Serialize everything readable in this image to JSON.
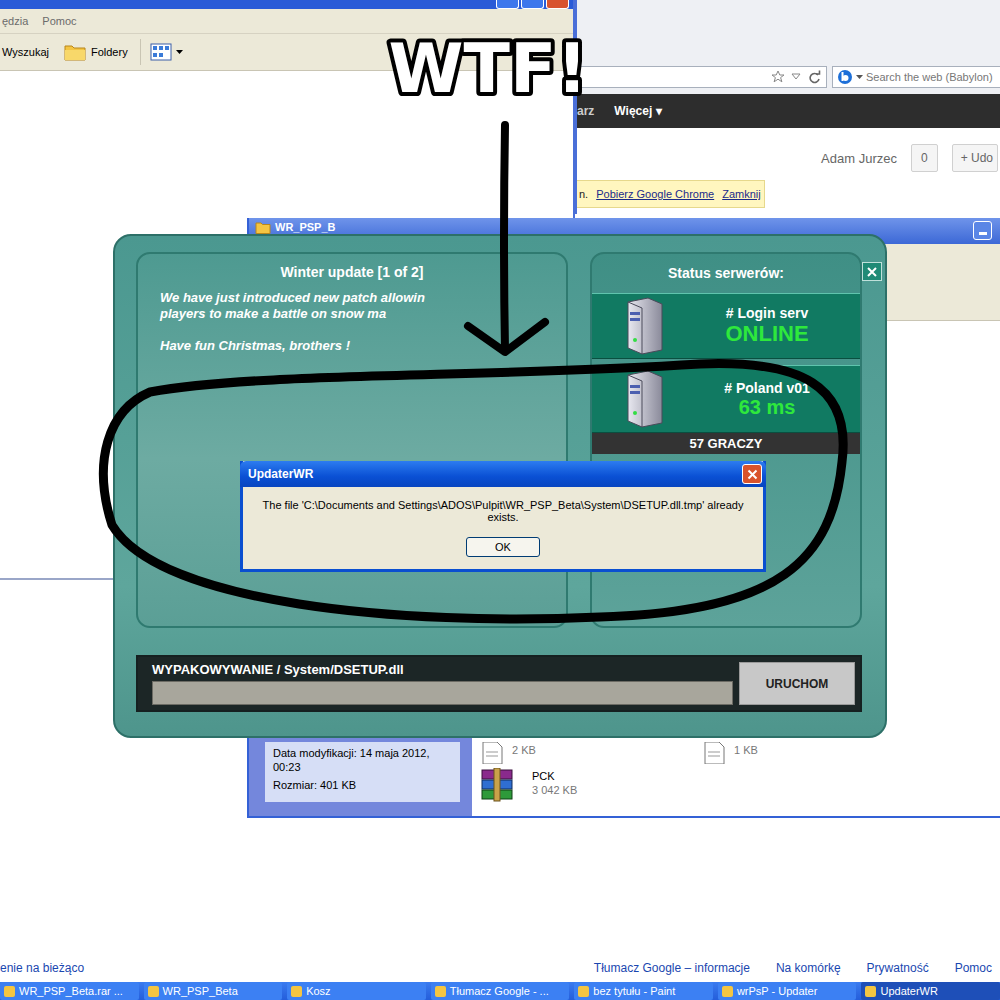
{
  "annotation": {
    "text": "WTF!"
  },
  "explorer": {
    "menu": [
      "ędzia",
      "Pomoc"
    ],
    "toolbar": [
      {
        "label": "Wyszukaj",
        "kind": "search"
      },
      {
        "label": "Foldery",
        "kind": "folders"
      }
    ]
  },
  "browser": {
    "search_placeholder": "Search the web (Babylon)",
    "nav": [
      "arz",
      "Więcej ▾"
    ],
    "user": "Adam Jurzec",
    "count": "0",
    "share": "+ Udo",
    "notice": {
      "prefix": "n.",
      "links": [
        "Pobierz Google Chrome",
        "Zamknij"
      ]
    }
  },
  "folder_window": {
    "title": "WR_PSP_B",
    "details": [
      "Data modyfikacji: 14 maja 2012,",
      "00:23"
    ],
    "size": "Rozmiar: 401 KB",
    "files": [
      {
        "kind": "file",
        "lines": [
          "2 KB"
        ]
      },
      {
        "kind": "file",
        "lines": [
          "1 KB"
        ]
      },
      {
        "kind": "archive",
        "lines": [
          "PCK",
          "3 042 KB"
        ]
      }
    ]
  },
  "updater": {
    "news": {
      "title": "Winter update [1 of 2]",
      "lines": [
        "We have just introduced new patch allowin",
        "players to make a battle on snow ma"
      ],
      "footer": "Have fun Christmas, brothers !"
    },
    "status_title": "Status serwerów:",
    "servers": [
      {
        "name": "# Login serv",
        "value": "ONLINE",
        "kind": "status"
      },
      {
        "name": "# Poland v01",
        "value": "63 ms",
        "kind": "ping"
      }
    ],
    "players": "57 GRACZY",
    "progress": {
      "label": "WYPAKOWYWANIE / System/DSETUP.dll",
      "level": 0
    },
    "button": "URUCHOM"
  },
  "dialog": {
    "title": "UpdaterWR",
    "message": "The file 'C:\\Documents and Settings\\ADOS\\Pulpit\\WR_PSP_Beta\\System\\DSETUP.dll.tmp' already exists.",
    "button": "OK"
  },
  "footer": {
    "left": "enie na bieżąco",
    "links": [
      "Tłumacz Google – informacje",
      "Na komórkę",
      "Prywatność",
      "Pomoc"
    ]
  },
  "taskbar": [
    {
      "label": "WR_PSP_Beta.rar ...",
      "selected": false
    },
    {
      "label": "WR_PSP_Beta",
      "selected": false
    },
    {
      "label": "Kosz",
      "selected": false
    },
    {
      "label": "Tłumacz Google - ...",
      "selected": false
    },
    {
      "label": "bez tytułu - Paint",
      "selected": false
    },
    {
      "label": "wrPsP - Updater",
      "selected": false
    },
    {
      "label": "UpdaterWR",
      "selected": true
    }
  ]
}
